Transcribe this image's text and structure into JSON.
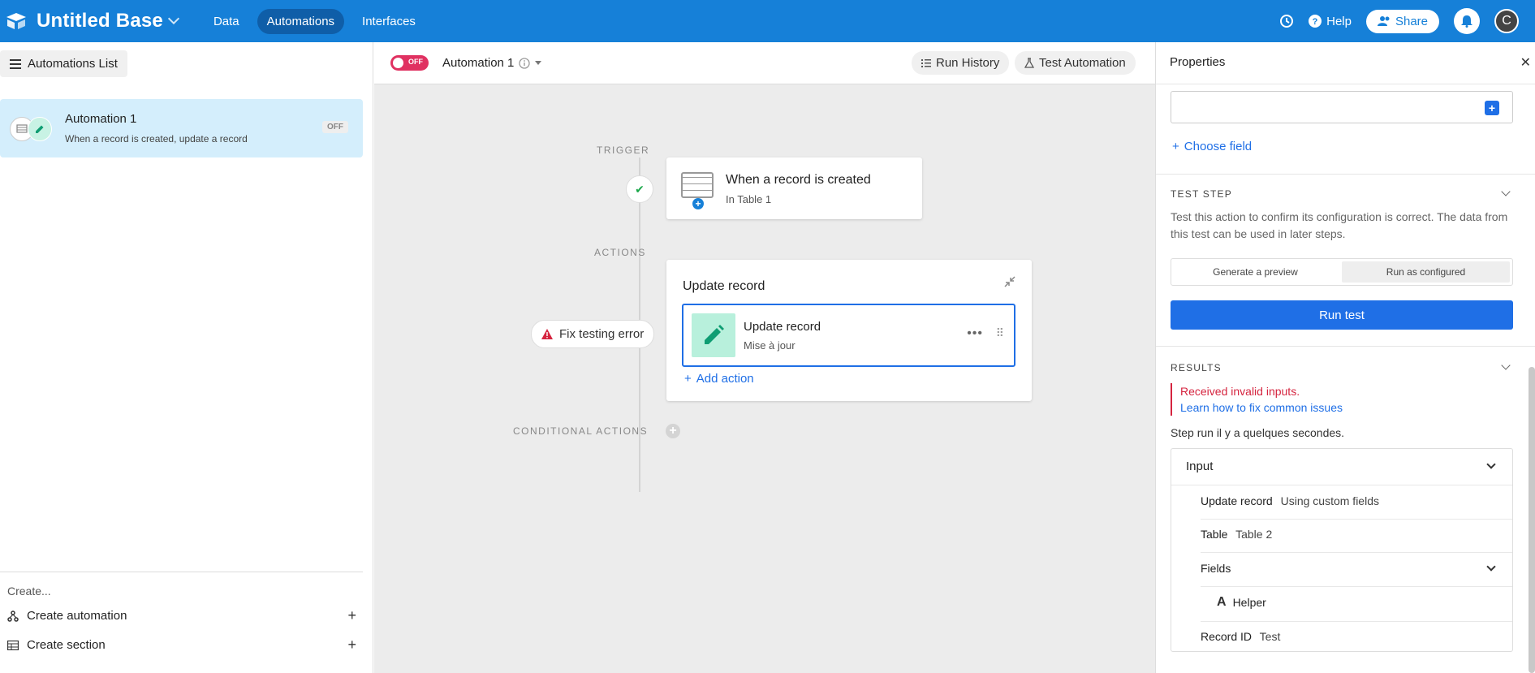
{
  "topbar": {
    "base_title": "Untitled Base",
    "nav": [
      "Data",
      "Automations",
      "Interfaces"
    ],
    "active_tab": "Automations",
    "help_label": "Help",
    "share_label": "Share",
    "avatar_initial": "C",
    "bg_color": "#1680d8"
  },
  "sidebar": {
    "list_button": "Automations List",
    "automation": {
      "name": "Automation 1",
      "desc": "When a record is created, update a record",
      "status": "OFF"
    },
    "create_label": "Create...",
    "create_automation": "Create automation",
    "create_section": "Create section"
  },
  "canvas_header": {
    "toggle_label": "OFF",
    "automation_name": "Automation 1",
    "run_history": "Run History",
    "test_automation": "Test Automation"
  },
  "canvas": {
    "trigger_label": "TRIGGER",
    "actions_label": "ACTIONS",
    "conditional_label": "CONDITIONAL ACTIONS",
    "trigger_title": "When a record is created",
    "trigger_sub": "In Table 1",
    "action_group_title": "Update record",
    "step_title": "Update record",
    "step_sub": "Mise à jour",
    "add_action": "Add action",
    "fix_error": "Fix testing error"
  },
  "properties": {
    "title": "Properties",
    "choose_field": "Choose field",
    "test_step_heading": "TEST STEP",
    "test_desc": "Test this action to confirm its configuration is correct. The data from this test can be used in later steps.",
    "seg_preview": "Generate a preview",
    "seg_configured": "Run as configured",
    "run_test": "Run test",
    "results_heading": "RESULTS",
    "error_text": "Received invalid inputs.",
    "error_link": "Learn how to fix common issues",
    "run_time": "Step run il y a quelques secondes.",
    "input_heading": "Input",
    "rows": {
      "update_record_key": "Update record",
      "update_record_val": "Using custom fields",
      "table_key": "Table",
      "table_val": "Table 2",
      "fields_key": "Fields",
      "helper": "Helper",
      "record_id_key": "Record ID",
      "record_id_val": "Test"
    }
  }
}
